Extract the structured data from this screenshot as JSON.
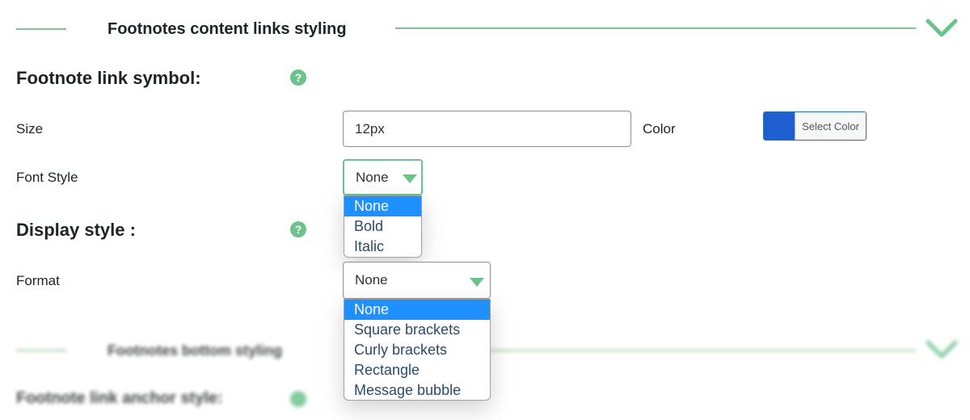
{
  "section1": {
    "title": "Footnotes content links styling",
    "icon": "chevron-down-icon"
  },
  "link_symbol": {
    "heading": "Footnote link symbol:",
    "help_glyph": "?"
  },
  "size": {
    "label": "Size",
    "value": "12px"
  },
  "color": {
    "label": "Color",
    "button_label": "Select Color",
    "swatch": "#1f5fd1"
  },
  "font_style": {
    "label": "Font Style",
    "selected": "None",
    "options": [
      "None",
      "Bold",
      "Italic"
    ],
    "highlighted": "None"
  },
  "display_style": {
    "heading": "Display style :",
    "help_glyph": "?"
  },
  "format": {
    "label": "Format",
    "selected": "None",
    "options": [
      "None",
      "Square brackets",
      "Curly brackets",
      "Rectangle",
      "Message bubble"
    ],
    "highlighted": "None"
  },
  "section2": {
    "title": "Footnotes bottom styling",
    "icon": "chevron-down-icon"
  },
  "anchor_style": {
    "heading": "Footnote link anchor style:"
  },
  "colors": {
    "accent": "#6cc28b",
    "line": "#7dc294",
    "highlight": "#1e90ff",
    "focus_border": "#6cc28b"
  }
}
